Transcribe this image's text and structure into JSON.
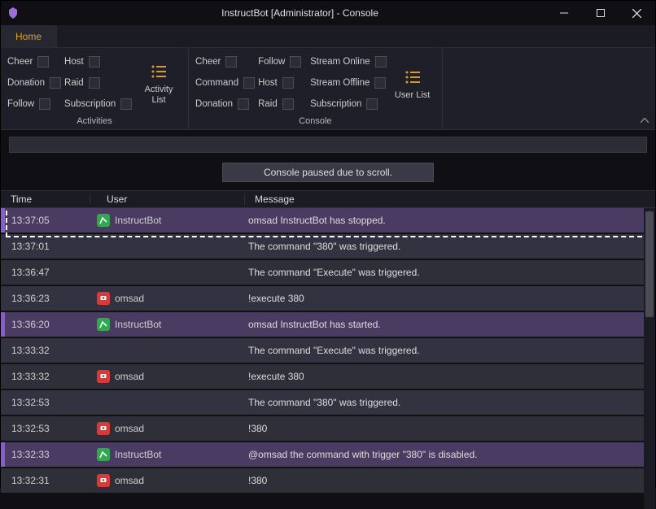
{
  "window": {
    "title": "InstructBot [Administrator] - Console"
  },
  "tabs": {
    "home": "Home"
  },
  "ribbon": {
    "groups": {
      "activities": {
        "name": "Activities",
        "items": {
          "cheer": "Cheer",
          "donation": "Donation",
          "follow": "Follow",
          "host": "Host",
          "raid": "Raid",
          "subscription": "Subscription"
        },
        "button": "Activity\nList"
      },
      "console": {
        "name": "Console",
        "items": {
          "cheer": "Cheer",
          "command": "Command",
          "donation": "Donation",
          "follow": "Follow",
          "host": "Host",
          "raid": "Raid",
          "stream_online": "Stream Online",
          "stream_offline": "Stream Offline",
          "subscription": "Subscription"
        },
        "button": "User List"
      }
    }
  },
  "banner": "Console paused due to scroll.",
  "columns": {
    "time": "Time",
    "user": "User",
    "message": "Message"
  },
  "rows": [
    {
      "time": "13:37:05",
      "user": "InstructBot",
      "badge": "green",
      "kind": "bot",
      "message": "omsad InstructBot has stopped."
    },
    {
      "time": "13:37:01",
      "user": "",
      "badge": "",
      "kind": "",
      "message": "The command \"380\" was triggered."
    },
    {
      "time": "13:36:47",
      "user": "",
      "badge": "",
      "kind": "",
      "message": "The command \"Execute\" was triggered."
    },
    {
      "time": "13:36:23",
      "user": "omsad",
      "badge": "red",
      "kind": "",
      "message": "!execute 380"
    },
    {
      "time": "13:36:20",
      "user": "InstructBot",
      "badge": "green",
      "kind": "bot",
      "message": "omsad InstructBot has started."
    },
    {
      "time": "13:33:32",
      "user": "",
      "badge": "",
      "kind": "",
      "message": "The command \"Execute\" was triggered."
    },
    {
      "time": "13:33:32",
      "user": "omsad",
      "badge": "red",
      "kind": "",
      "message": "!execute 380"
    },
    {
      "time": "13:32:53",
      "user": "",
      "badge": "",
      "kind": "",
      "message": "The command \"380\" was triggered."
    },
    {
      "time": "13:32:53",
      "user": "omsad",
      "badge": "red",
      "kind": "",
      "message": "!380"
    },
    {
      "time": "13:32:33",
      "user": "InstructBot",
      "badge": "green",
      "kind": "bot",
      "message": "@omsad the command with trigger \"380\" is disabled."
    },
    {
      "time": "13:32:31",
      "user": "omsad",
      "badge": "red",
      "kind": "",
      "message": "!380"
    }
  ]
}
